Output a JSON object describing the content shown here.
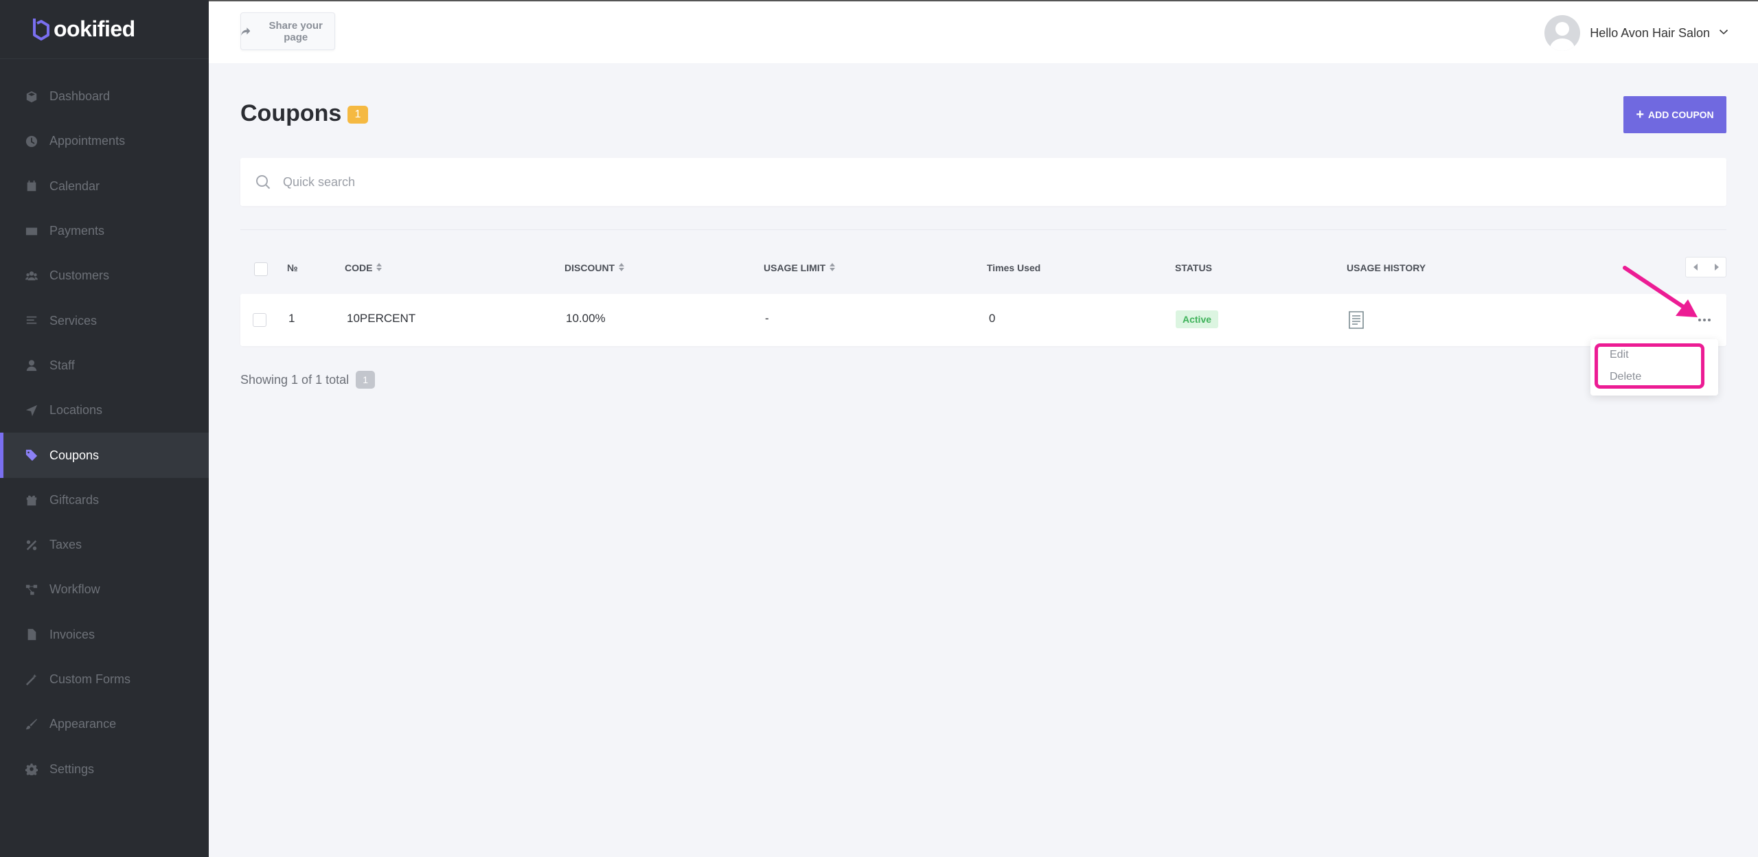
{
  "brand": {
    "name": "ookified"
  },
  "sidebar": {
    "items": [
      {
        "label": "Dashboard",
        "icon": "cube-icon"
      },
      {
        "label": "Appointments",
        "icon": "clock-icon"
      },
      {
        "label": "Calendar",
        "icon": "calendar-icon"
      },
      {
        "label": "Payments",
        "icon": "credit-card-icon"
      },
      {
        "label": "Customers",
        "icon": "users-icon"
      },
      {
        "label": "Services",
        "icon": "list-icon"
      },
      {
        "label": "Staff",
        "icon": "user-icon"
      },
      {
        "label": "Locations",
        "icon": "location-arrow-icon"
      },
      {
        "label": "Coupons",
        "icon": "tag-icon",
        "active": true
      },
      {
        "label": "Giftcards",
        "icon": "gift-icon"
      },
      {
        "label": "Taxes",
        "icon": "percent-icon"
      },
      {
        "label": "Workflow",
        "icon": "workflow-icon"
      },
      {
        "label": "Invoices",
        "icon": "file-icon"
      },
      {
        "label": "Custom Forms",
        "icon": "magic-wand-icon"
      },
      {
        "label": "Appearance",
        "icon": "brush-icon"
      },
      {
        "label": "Settings",
        "icon": "gear-icon"
      }
    ]
  },
  "topbar": {
    "share_label": "Share your page",
    "user_greeting": "Hello Avon Hair Salon"
  },
  "page": {
    "title": "Coupons",
    "count": "1",
    "add_button": "ADD COUPON",
    "search_placeholder": "Quick search"
  },
  "table": {
    "headers": {
      "number": "№",
      "code": "CODE",
      "discount": "DISCOUNT",
      "usage_limit": "USAGE LIMIT",
      "times_used": "Times Used",
      "status": "STATUS",
      "usage_history": "USAGE HISTORY"
    },
    "rows": [
      {
        "number": "1",
        "code": "10PERCENT",
        "discount": "10.00%",
        "usage_limit": "-",
        "times_used": "0",
        "status": "Active"
      }
    ]
  },
  "footer": {
    "showing": "Showing 1 of 1 total",
    "page": "1"
  },
  "dropdown": {
    "edit": "Edit",
    "delete": "Delete"
  },
  "colors": {
    "accent": "#7069e0",
    "sidebar_bg": "#292c31",
    "badge": "#f5b942",
    "status_active_bg": "#dcf5e1",
    "status_active_text": "#3fb25a",
    "annotation": "#ec1c94"
  }
}
